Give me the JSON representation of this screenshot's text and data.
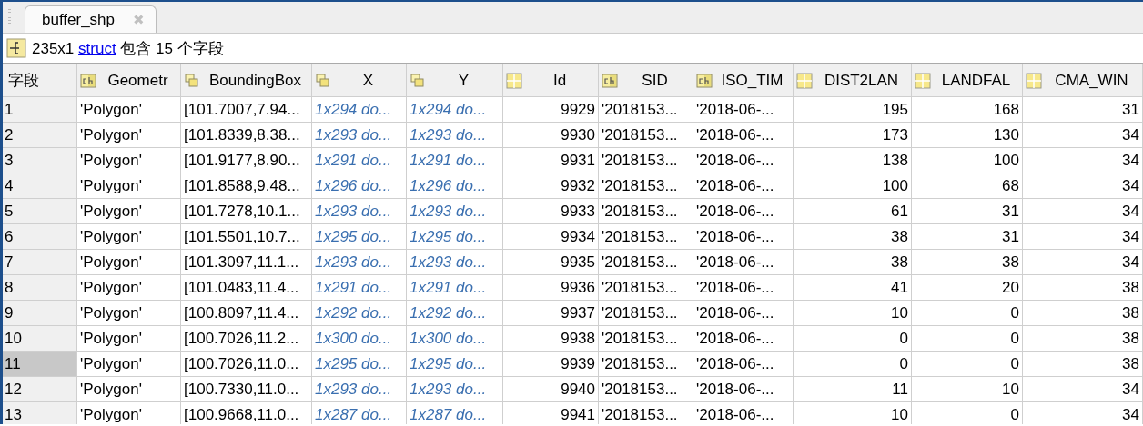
{
  "tabs": [
    {
      "label": "buffer_shp",
      "selected": true,
      "close": "✖"
    }
  ],
  "info": {
    "size": "235x1",
    "link": "struct",
    "rest": "包含 15 个字段"
  },
  "table": {
    "corner": "字段",
    "columns": [
      {
        "label": "Geometr",
        "kind": "text"
      },
      {
        "label": "BoundingBox",
        "kind": "array"
      },
      {
        "label": "X",
        "kind": "reference"
      },
      {
        "label": "Y",
        "kind": "reference"
      },
      {
        "label": "Id",
        "kind": "number"
      },
      {
        "label": "SID",
        "kind": "text"
      },
      {
        "label": "ISO_TIM",
        "kind": "text"
      },
      {
        "label": "DIST2LAN",
        "kind": "number"
      },
      {
        "label": "LANDFAL",
        "kind": "number"
      },
      {
        "label": "CMA_WIN",
        "kind": "number"
      }
    ],
    "rows": [
      {
        "index": "1",
        "selected": false,
        "cells": [
          "'Polygon'",
          "[101.7007,7.94...",
          "1x294 do...",
          "1x294 do...",
          "9929",
          "'2018153...",
          "'2018-06-...",
          "195",
          "168",
          "31"
        ]
      },
      {
        "index": "2",
        "selected": false,
        "cells": [
          "'Polygon'",
          "[101.8339,8.38...",
          "1x293 do...",
          "1x293 do...",
          "9930",
          "'2018153...",
          "'2018-06-...",
          "173",
          "130",
          "34"
        ]
      },
      {
        "index": "3",
        "selected": false,
        "cells": [
          "'Polygon'",
          "[101.9177,8.90...",
          "1x291 do...",
          "1x291 do...",
          "9931",
          "'2018153...",
          "'2018-06-...",
          "138",
          "100",
          "34"
        ]
      },
      {
        "index": "4",
        "selected": false,
        "cells": [
          "'Polygon'",
          "[101.8588,9.48...",
          "1x296 do...",
          "1x296 do...",
          "9932",
          "'2018153...",
          "'2018-06-...",
          "100",
          "68",
          "34"
        ]
      },
      {
        "index": "5",
        "selected": false,
        "cells": [
          "'Polygon'",
          "[101.7278,10.1...",
          "1x293 do...",
          "1x293 do...",
          "9933",
          "'2018153...",
          "'2018-06-...",
          "61",
          "31",
          "34"
        ]
      },
      {
        "index": "6",
        "selected": false,
        "cells": [
          "'Polygon'",
          "[101.5501,10.7...",
          "1x295 do...",
          "1x295 do...",
          "9934",
          "'2018153...",
          "'2018-06-...",
          "38",
          "31",
          "34"
        ]
      },
      {
        "index": "7",
        "selected": false,
        "cells": [
          "'Polygon'",
          "[101.3097,11.1...",
          "1x293 do...",
          "1x293 do...",
          "9935",
          "'2018153...",
          "'2018-06-...",
          "38",
          "38",
          "34"
        ]
      },
      {
        "index": "8",
        "selected": false,
        "cells": [
          "'Polygon'",
          "[101.0483,11.4...",
          "1x291 do...",
          "1x291 do...",
          "9936",
          "'2018153...",
          "'2018-06-...",
          "41",
          "20",
          "38"
        ]
      },
      {
        "index": "9",
        "selected": false,
        "cells": [
          "'Polygon'",
          "[100.8097,11.4...",
          "1x292 do...",
          "1x292 do...",
          "9937",
          "'2018153...",
          "'2018-06-...",
          "10",
          "0",
          "38"
        ]
      },
      {
        "index": "10",
        "selected": false,
        "cells": [
          "'Polygon'",
          "[100.7026,11.2...",
          "1x300 do...",
          "1x300 do...",
          "9938",
          "'2018153...",
          "'2018-06-...",
          "0",
          "0",
          "38"
        ]
      },
      {
        "index": "11",
        "selected": true,
        "cells": [
          "'Polygon'",
          "[100.7026,11.0...",
          "1x295 do...",
          "1x295 do...",
          "9939",
          "'2018153...",
          "'2018-06-...",
          "0",
          "0",
          "38"
        ]
      },
      {
        "index": "12",
        "selected": false,
        "cells": [
          "'Polygon'",
          "[100.7330,11.0...",
          "1x293 do...",
          "1x293 do...",
          "9940",
          "'2018153...",
          "'2018-06-...",
          "11",
          "10",
          "34"
        ]
      },
      {
        "index": "13",
        "selected": false,
        "cells": [
          "'Polygon'",
          "[100.9668,11.0...",
          "1x287 do...",
          "1x287 do...",
          "9941",
          "'2018153...",
          "'2018-06-...",
          "10",
          "0",
          "34"
        ]
      }
    ]
  }
}
